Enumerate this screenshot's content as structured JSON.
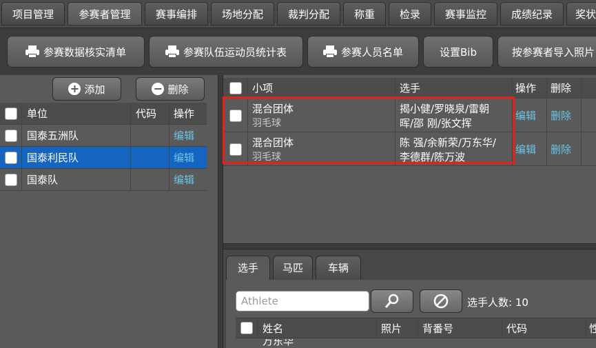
{
  "top_tabs": [
    "项目管理",
    "参赛者管理",
    "赛事编排",
    "场地分配",
    "裁判分配",
    "称重",
    "检录",
    "赛事监控",
    "成绩纪录",
    "奖状"
  ],
  "toolbar": {
    "btn1": "参赛数据核实清单",
    "btn2": "参赛队伍运动员统计表",
    "btn3": "参赛人员名单",
    "btn4": "设置Bib",
    "btn5": "按参赛者导入照片"
  },
  "left": {
    "add_label": "添加",
    "delete_label": "删除",
    "headers": {
      "unit": "单位",
      "code": "代码",
      "op": "操作"
    },
    "rows": [
      {
        "unit": "国泰五洲队",
        "code": "",
        "op": "编辑"
      },
      {
        "unit": "国泰利民队",
        "code": "",
        "op": "编辑"
      },
      {
        "unit": "国泰队",
        "code": "",
        "op": "编辑"
      }
    ]
  },
  "events": {
    "headers": {
      "item": "小项",
      "athletes": "选手",
      "op": "操作",
      "del": "删除"
    },
    "rows": [
      {
        "item": "混合团体",
        "sport": "羽毛球",
        "athletes_l1": "揭小健/罗晓泉/雷朝",
        "athletes_l2": "晖/邵 刚/张文挥",
        "op": "编辑",
        "del": "删除"
      },
      {
        "item": "混合团体",
        "sport": "羽毛球",
        "athletes_l1": "陈 强/余新荣/万东华/",
        "athletes_l2": "李德群/陈万波",
        "op": "编辑",
        "del": "删除"
      }
    ]
  },
  "bottom": {
    "tabs": [
      "选手",
      "马匹",
      "车辆"
    ],
    "search_placeholder": "Athlete",
    "count_label": "选手人数: 10",
    "headers": {
      "name": "姓名",
      "photo": "照片",
      "bib": "背番号",
      "code": "代码",
      "gender": "性"
    },
    "first_row_name": "万东华"
  },
  "colors": {
    "selected_row": "#1565c0",
    "link": "#6bc3e6",
    "highlight_box": "#e8201a"
  }
}
